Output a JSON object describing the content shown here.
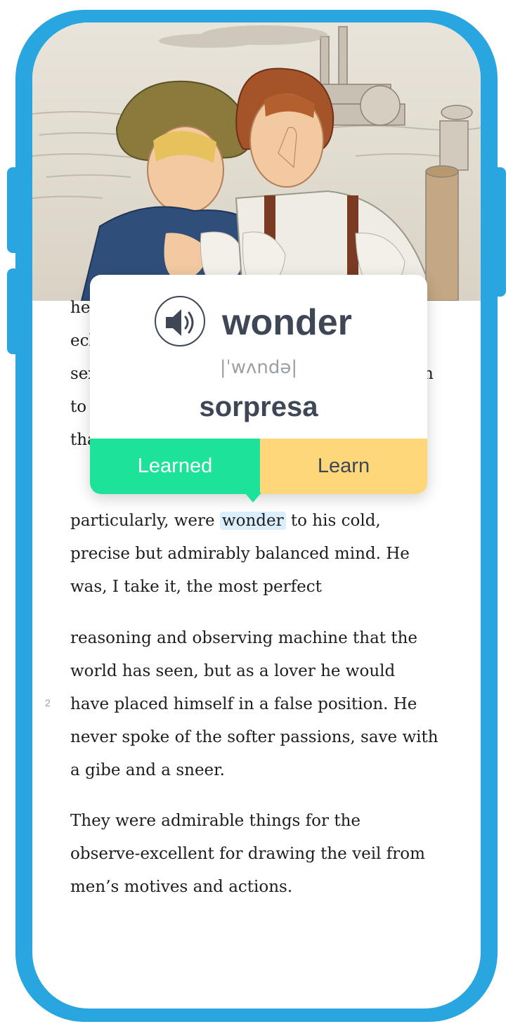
{
  "colors": {
    "frame": "#29a6df",
    "learned": "#1de29a",
    "learn": "#fdd779",
    "highlight": "#dbeefb",
    "heading": "#3f4756"
  },
  "illustration": {
    "icon": "book-illustration-image"
  },
  "reader": {
    "hidden_fragments": [
      "he",
      "ecl",
      "sex",
      "to",
      "tha"
    ],
    "right_edge_fragment": "n",
    "para1": {
      "before": "particularly, were ",
      "highlighted": "wonder",
      "after": " to his cold,",
      "line2": "precise but admirably balanced mind. He",
      "line3": "was, I take it, the most perfect"
    },
    "para2": [
      "reasoning and observing machine that the",
      "world has seen, but as a lover he would",
      "have placed himself in a false position. He",
      "never spoke of the softer passions, save with",
      "a gibe and a sneer."
    ],
    "para3": [
      "They were admirable things for the",
      "observe-excellent for drawing the veil from",
      "men’s motives and actions."
    ],
    "page_number": "2"
  },
  "popup": {
    "speaker_icon": "speaker-icon",
    "word": "wonder",
    "phonetic": "|ˈwʌndə|",
    "translation": "sorpresa",
    "learned_label": "Learned",
    "learn_label": "Learn"
  }
}
